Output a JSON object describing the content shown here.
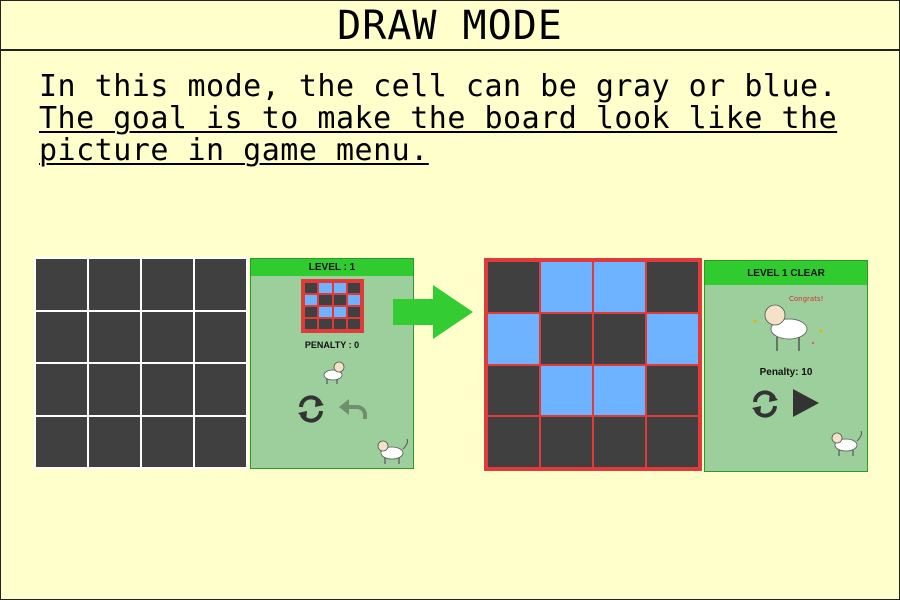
{
  "title": "DRAW MODE",
  "description": {
    "line1": "In this mode, the cell can be gray or blue.",
    "line2": "The goal is to make the board look like the",
    "line3": "picture in game menu."
  },
  "left_example": {
    "board": [
      [
        "gray",
        "gray",
        "gray",
        "gray"
      ],
      [
        "gray",
        "gray",
        "gray",
        "gray"
      ],
      [
        "gray",
        "gray",
        "gray",
        "gray"
      ],
      [
        "gray",
        "gray",
        "gray",
        "gray"
      ]
    ],
    "panel": {
      "header": "LEVEL : 1",
      "target_picture": [
        [
          "gray",
          "blue",
          "blue",
          "gray"
        ],
        [
          "blue",
          "gray",
          "gray",
          "blue"
        ],
        [
          "gray",
          "blue",
          "blue",
          "gray"
        ],
        [
          "gray",
          "gray",
          "gray",
          "gray"
        ]
      ],
      "penalty": "PENALTY : 0",
      "icons": [
        "reset-icon",
        "undo-icon"
      ]
    }
  },
  "right_example": {
    "board": [
      [
        "gray",
        "blue",
        "blue",
        "gray"
      ],
      [
        "blue",
        "gray",
        "gray",
        "blue"
      ],
      [
        "gray",
        "blue",
        "blue",
        "gray"
      ],
      [
        "gray",
        "gray",
        "gray",
        "gray"
      ]
    ],
    "panel": {
      "header": "LEVEL 1 CLEAR",
      "mascot_text": "Congrats!",
      "penalty": "Penalty: 10",
      "icons": [
        "reset-icon",
        "play-icon"
      ]
    }
  },
  "colors": {
    "background": "#ffffcc",
    "cell_gray": "#404040",
    "cell_blue": "#6db3ff",
    "panel_green": "#9dcf9d",
    "header_green": "#2fcb2f",
    "highlight_red": "#e03a3a",
    "arrow_green": "#33cc33"
  }
}
